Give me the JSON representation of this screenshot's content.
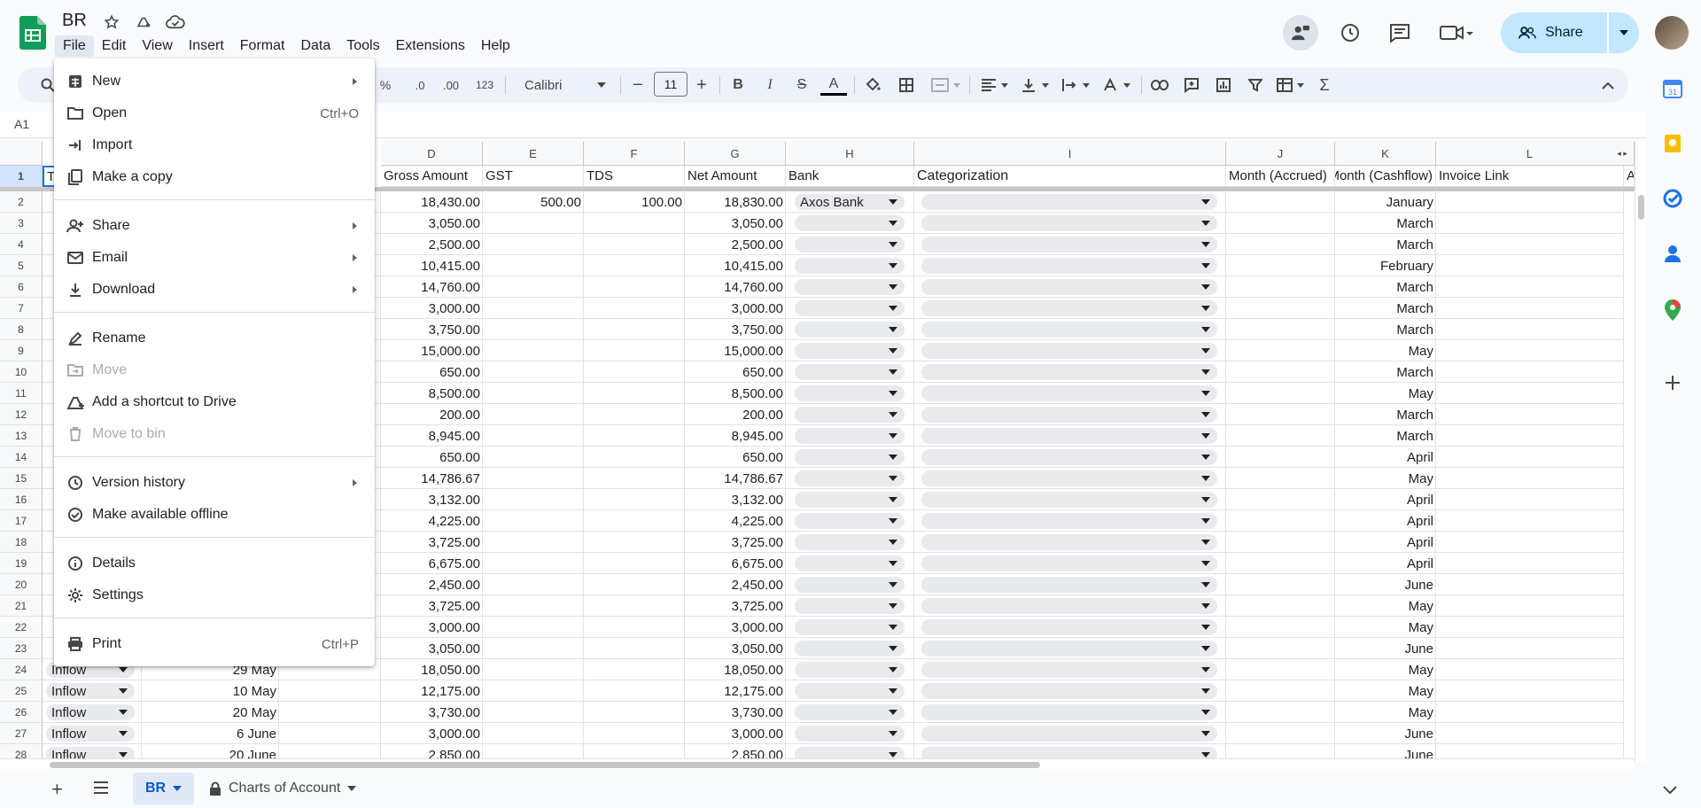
{
  "doc": {
    "title": "BR"
  },
  "menubar": [
    "File",
    "Edit",
    "View",
    "Insert",
    "Format",
    "Data",
    "Tools",
    "Extensions",
    "Help"
  ],
  "share": {
    "label": "Share"
  },
  "toolbar": {
    "percent": "%",
    "dec_decrease": ".0",
    "dec_increase": ".00",
    "format_123": "123",
    "font": "Calibri",
    "font_size": "11",
    "bold": "B",
    "italic": "I",
    "strike": "S",
    "text_color": "A",
    "sum": "Σ"
  },
  "namebox": "A1",
  "columns": [
    "D",
    "E",
    "F",
    "G",
    "H",
    "I",
    "J",
    "K",
    "L"
  ],
  "header_row": {
    "row_num": "1",
    "a": "T",
    "d": "Gross Amount",
    "e": "GST",
    "f": "TDS",
    "g": "Net Amount",
    "h": "Bank",
    "i": "Categorization",
    "j": "Month (Accrued)",
    "k": "Month (Cashflow)",
    "l": "Invoice Link",
    "m": "A"
  },
  "rows": [
    {
      "n": "2",
      "gross": "18,430.00",
      "gst": "500.00",
      "tds": "100.00",
      "net": "18,830.00",
      "bank": "Axos Bank",
      "month": "January"
    },
    {
      "n": "3",
      "gross": "3,050.00",
      "gst": "",
      "tds": "",
      "net": "3,050.00",
      "bank": "",
      "month": "March"
    },
    {
      "n": "4",
      "gross": "2,500.00",
      "gst": "",
      "tds": "",
      "net": "2,500.00",
      "bank": "",
      "month": "March"
    },
    {
      "n": "5",
      "gross": "10,415.00",
      "gst": "",
      "tds": "",
      "net": "10,415.00",
      "bank": "",
      "month": "February"
    },
    {
      "n": "6",
      "gross": "14,760.00",
      "gst": "",
      "tds": "",
      "net": "14,760.00",
      "bank": "",
      "month": "March"
    },
    {
      "n": "7",
      "gross": "3,000.00",
      "gst": "",
      "tds": "",
      "net": "3,000.00",
      "bank": "",
      "month": "March"
    },
    {
      "n": "8",
      "gross": "3,750.00",
      "gst": "",
      "tds": "",
      "net": "3,750.00",
      "bank": "",
      "month": "March"
    },
    {
      "n": "9",
      "gross": "15,000.00",
      "gst": "",
      "tds": "",
      "net": "15,000.00",
      "bank": "",
      "month": "May"
    },
    {
      "n": "10",
      "gross": "650.00",
      "gst": "",
      "tds": "",
      "net": "650.00",
      "bank": "",
      "month": "March"
    },
    {
      "n": "11",
      "gross": "8,500.00",
      "gst": "",
      "tds": "",
      "net": "8,500.00",
      "bank": "",
      "month": "May"
    },
    {
      "n": "12",
      "gross": "200.00",
      "gst": "",
      "tds": "",
      "net": "200.00",
      "bank": "",
      "month": "March"
    },
    {
      "n": "13",
      "gross": "8,945.00",
      "gst": "",
      "tds": "",
      "net": "8,945.00",
      "bank": "",
      "month": "March"
    },
    {
      "n": "14",
      "gross": "650.00",
      "gst": "",
      "tds": "",
      "net": "650.00",
      "bank": "",
      "month": "April"
    },
    {
      "n": "15",
      "gross": "14,786.67",
      "gst": "",
      "tds": "",
      "net": "14,786.67",
      "bank": "",
      "month": "May"
    },
    {
      "n": "16",
      "gross": "3,132.00",
      "gst": "",
      "tds": "",
      "net": "3,132.00",
      "bank": "",
      "month": "April"
    },
    {
      "n": "17",
      "gross": "4,225.00",
      "gst": "",
      "tds": "",
      "net": "4,225.00",
      "bank": "",
      "month": "April"
    },
    {
      "n": "18",
      "gross": "3,725.00",
      "gst": "",
      "tds": "",
      "net": "3,725.00",
      "bank": "",
      "month": "April"
    },
    {
      "n": "19",
      "gross": "6,675.00",
      "gst": "",
      "tds": "",
      "net": "6,675.00",
      "bank": "",
      "month": "April"
    },
    {
      "n": "20",
      "gross": "2,450.00",
      "gst": "",
      "tds": "",
      "net": "2,450.00",
      "bank": "",
      "month": "June"
    },
    {
      "n": "21",
      "gross": "3,725.00",
      "gst": "",
      "tds": "",
      "net": "3,725.00",
      "bank": "",
      "month": "May"
    },
    {
      "n": "22",
      "gross": "3,000.00",
      "gst": "",
      "tds": "",
      "net": "3,000.00",
      "bank": "",
      "month": "May"
    },
    {
      "n": "23",
      "gross": "3,050.00",
      "gst": "",
      "tds": "",
      "net": "3,050.00",
      "bank": "",
      "month": "June"
    },
    {
      "n": "24",
      "type": "Inflow",
      "date": "29 May",
      "gross": "18,050.00",
      "gst": "",
      "tds": "",
      "net": "18,050.00",
      "bank": "",
      "month": "May"
    },
    {
      "n": "25",
      "type": "Inflow",
      "date": "10 May",
      "gross": "12,175.00",
      "gst": "",
      "tds": "",
      "net": "12,175.00",
      "bank": "",
      "month": "May"
    },
    {
      "n": "26",
      "type": "Inflow",
      "date": "20 May",
      "gross": "3,730.00",
      "gst": "",
      "tds": "",
      "net": "3,730.00",
      "bank": "",
      "month": "May"
    },
    {
      "n": "27",
      "type": "Inflow",
      "date": "6 June",
      "gross": "3,000.00",
      "gst": "",
      "tds": "",
      "net": "3,000.00",
      "bank": "",
      "month": "June"
    },
    {
      "n": "28",
      "type": "Inflow",
      "date": "20 June",
      "gross": "2,850.00",
      "gst": "",
      "tds": "",
      "net": "2,850.00",
      "bank": "",
      "month": "June"
    }
  ],
  "file_menu": {
    "new": "New",
    "open": "Open",
    "open_sc": "Ctrl+O",
    "import": "Import",
    "copy": "Make a copy",
    "share": "Share",
    "email": "Email",
    "download": "Download",
    "rename": "Rename",
    "move": "Move",
    "shortcut": "Add a shortcut to Drive",
    "bin": "Move to bin",
    "version": "Version history",
    "offline": "Make available offline",
    "details": "Details",
    "settings": "Settings",
    "print": "Print",
    "print_sc": "Ctrl+P"
  },
  "sheets": {
    "active": "BR",
    "other": "Charts of Account"
  },
  "colors": {
    "accent": "#0b57d0",
    "share_bg": "#c2e7ff",
    "sheets_green": "#0f9d58"
  }
}
